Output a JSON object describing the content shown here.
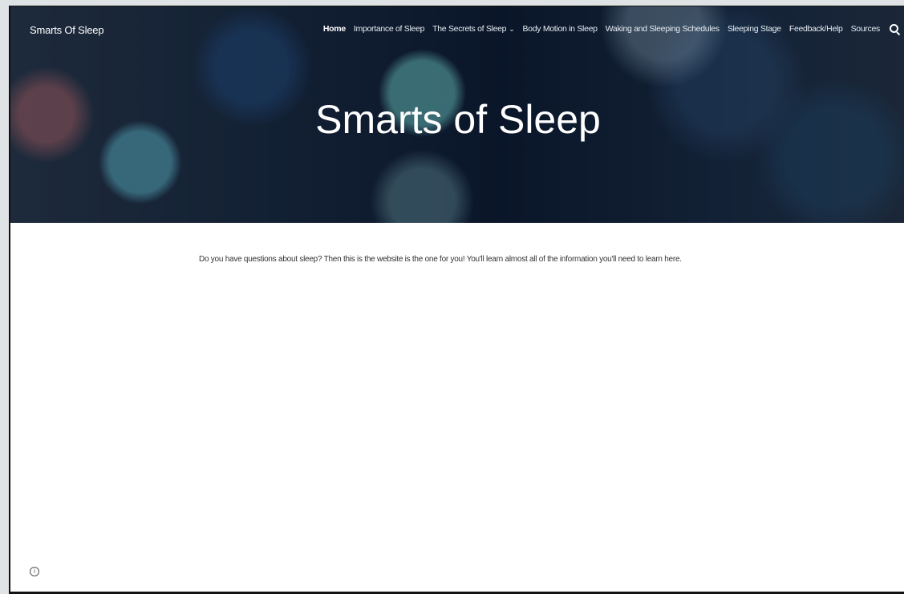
{
  "site": {
    "title": "Smarts Of Sleep"
  },
  "nav": {
    "items": [
      {
        "label": "Home"
      },
      {
        "label": "Importance of Sleep"
      },
      {
        "label": "The Secrets of Sleep"
      },
      {
        "label": "Body Motion in Sleep"
      },
      {
        "label": "Waking and Sleeping Schedules"
      },
      {
        "label": "Sleeping Stage"
      },
      {
        "label": "Feedback/Help"
      },
      {
        "label": "Sources"
      }
    ],
    "dropdown_icon": "chevron-down-icon",
    "search_icon": "search-icon"
  },
  "hero": {
    "title": "Smarts of Sleep"
  },
  "main": {
    "intro": "Do you have questions about sleep? Then this is the website is the one for you! You'll learn almost all of the information you'll need to learn here."
  },
  "footer": {
    "info_icon": "info-icon",
    "info_glyph": "i"
  }
}
